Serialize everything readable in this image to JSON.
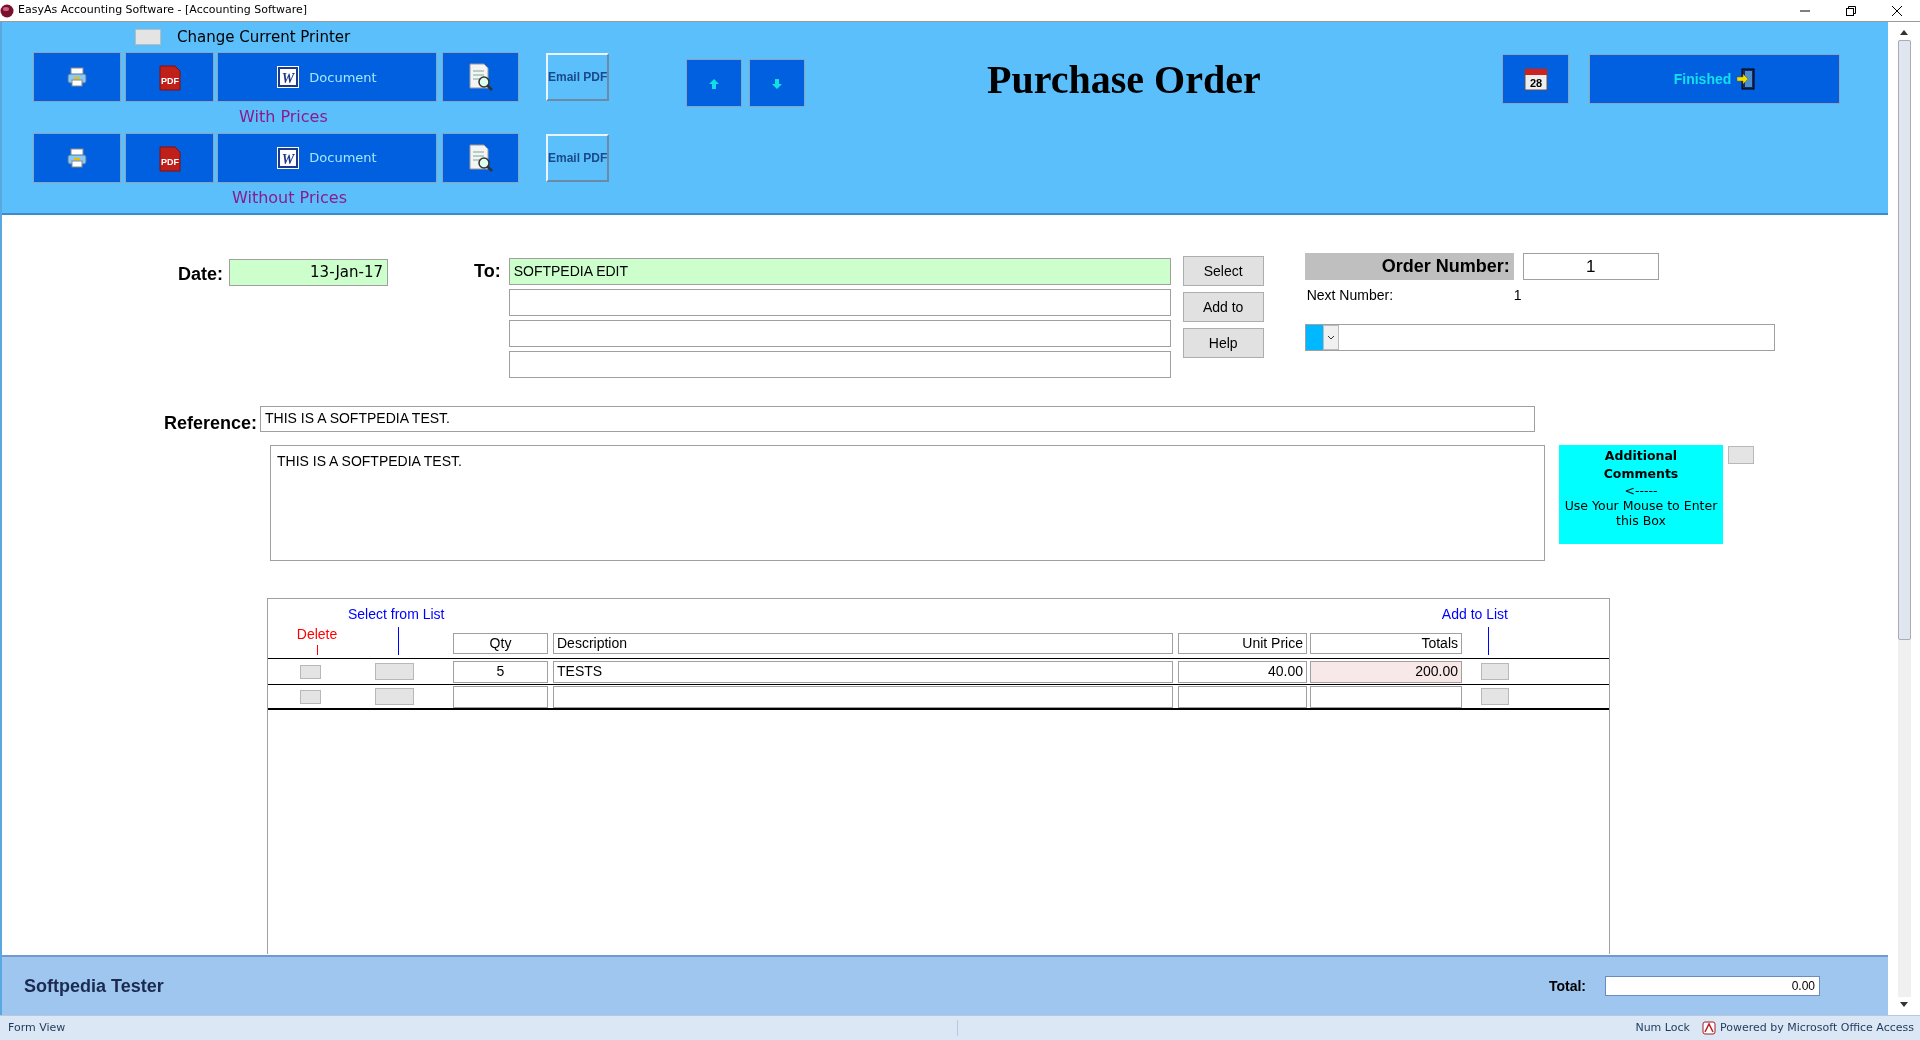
{
  "window": {
    "title": "EasyAs Accounting Software - [Accounting Software]"
  },
  "header": {
    "printer_toggle": {
      "label": "Change Current Printer",
      "checked": false
    },
    "output_groups": [
      {
        "caption": "With Prices",
        "pdf_icon_text": "PDF",
        "word_icon_text": "W",
        "document_label": "Document",
        "email_label": "Email PDF"
      },
      {
        "caption": "Without Prices",
        "pdf_icon_text": "PDF",
        "word_icon_text": "W",
        "document_label": "Document",
        "email_label": "Email PDF"
      }
    ],
    "title": "Purchase Order",
    "calendar_day": "28",
    "finished_label": "Finished"
  },
  "form": {
    "date": {
      "label": "Date:",
      "value": "13-Jan-17"
    },
    "to": {
      "label": "To:",
      "lines": [
        "SOFTPEDIA EDIT"
      ]
    },
    "to_buttons": [
      "Select",
      "Add to",
      "Help"
    ],
    "order": {
      "label": "Order Number:",
      "value": "1",
      "next_label": "Next Number:",
      "next_value": "1"
    },
    "reference": {
      "label": "Reference:",
      "value": "THIS IS A SOFTPEDIA TEST.",
      "comments": "THIS IS A SOFTPEDIA TEST."
    },
    "comments_hint": {
      "title": "Additional Comments",
      "lines": [
        "<-----",
        "Use Your Mouse to Enter this Box"
      ]
    }
  },
  "lines_table": {
    "select_from_list": "Select from List",
    "delete": "Delete",
    "add_to_list": "Add to List",
    "columns": [
      "Qty",
      "Description",
      "Unit Price",
      "Totals"
    ],
    "rows": [
      {
        "qty": "5",
        "description": "TESTS",
        "unit_price": "40.00",
        "total": "200.00"
      }
    ]
  },
  "footer": {
    "user": "Softpedia Tester",
    "total_label": "Total:",
    "total": "0.00"
  },
  "status_bar": {
    "mode": "Form View",
    "num_lock": "Num Lock",
    "powered_by": "Powered by Microsoft Office Access"
  }
}
